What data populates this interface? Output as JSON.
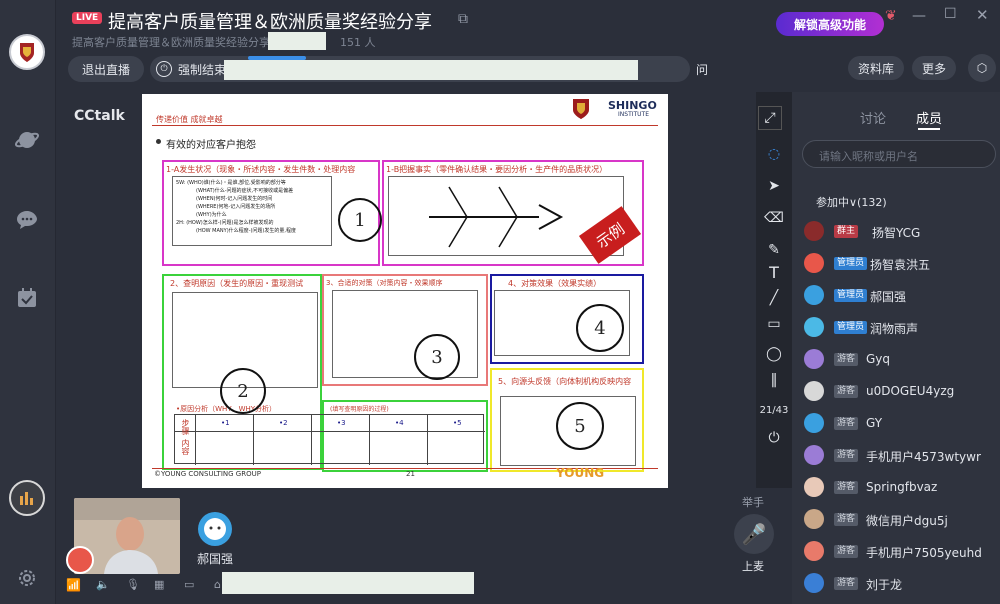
{
  "header": {
    "live_badge": "LIVE",
    "title": "提高客户质量管理＆欧洲质量奖经验分享",
    "subtitle": "提高客户质量管理＆欧洲质量奖经验分享",
    "viewers": "151 人",
    "exit_label": "退出直播",
    "force_end_label": "强制结束",
    "trailing_text": "问"
  },
  "promo": {
    "label": "解锁高级功能"
  },
  "toolbar": {
    "library_label": "资料库",
    "more_label": "更多"
  },
  "brand": {
    "cctalk": "CCtalk"
  },
  "slide": {
    "slogan": "传递价值 成就卓越",
    "logo_text": "SHINGO",
    "logo_sub": "INSTITUTE",
    "heading": "有效的对应客户抱怨",
    "sec1a": "1-A发生状况（现象・所述内容・发生件数・处理内容",
    "sec1b": "1-B把握事实（零件确认结果・要因分析・生产件的品质状况）",
    "sec2": "2、查明原因（发生的原因・重现测试",
    "sec3": "3、合适的对策（对策内容・效果顺序",
    "sec4": "4、对策效果（效果实绩）",
    "sec5": "5、向源头反馈（向体制机构反映内容",
    "w5h": [
      "5W:  (WHO)谁(什么)・是谁,部位,受影响的部分等",
      "(WHAT)什么-问题的症状,不可接收或是偏差",
      "(WHEN)何时-记入问题发生的时间",
      "(WHERE)何地-记入问题发生的场所",
      "(WHY)为什么",
      "2H:  (HOW)怎么样-(问题)是怎么样被发现的",
      "(HOW MANY)什么程度-(问题)发生的量,程度"
    ],
    "stamp": "示例",
    "nums": [
      "1",
      "2",
      "3",
      "4",
      "5"
    ],
    "why_label": "•原因分析（WHY、WHY分析）",
    "fill_label": "(填写查明原因的过程)",
    "steps_label": "步骤",
    "content_label": "内容",
    "step_cols": [
      "•1",
      "•2",
      "•3",
      "•4",
      "•5"
    ],
    "footer_left": "©YOUNG CONSULTING GROUP",
    "page_no": "21",
    "footer_brand": "YOUNG"
  },
  "tools": {
    "page": "21/43"
  },
  "panel": {
    "tab_discuss": "讨论",
    "tab_members": "成员",
    "search_placeholder": "请输入昵称或用户名",
    "joined": "参加中∨(132)"
  },
  "members": [
    {
      "badge": "群主",
      "type": "host",
      "name": "扬智YCG",
      "avatar_color": "#8a2b2b"
    },
    {
      "badge": "管理员",
      "type": "admin",
      "name": "扬智袁洪五",
      "avatar_color": "#e8574a"
    },
    {
      "badge": "管理员",
      "type": "admin",
      "name": "郝国强",
      "avatar_color": "#3aa0e0"
    },
    {
      "badge": "管理员",
      "type": "admin",
      "name": "润物雨声",
      "avatar_color": "#4bb9e6"
    },
    {
      "badge": "游客",
      "type": "guest",
      "name": "Gyq",
      "avatar_color": "#9b7cd6"
    },
    {
      "badge": "游客",
      "type": "guest",
      "name": "u0DOGEU4yzg",
      "avatar_color": "#d8d8d8"
    },
    {
      "badge": "游客",
      "type": "guest",
      "name": "GY",
      "avatar_color": "#3aa0e0"
    },
    {
      "badge": "游客",
      "type": "guest",
      "name": "手机用户4573wtywr",
      "avatar_color": "#9b7cd6"
    },
    {
      "badge": "游客",
      "type": "guest",
      "name": "Springfbvaz",
      "avatar_color": "#e8c9b8"
    },
    {
      "badge": "游客",
      "type": "guest",
      "name": "微信用户dgu5j",
      "avatar_color": "#c9a788"
    },
    {
      "badge": "游客",
      "type": "guest",
      "name": "手机用户7505yeuhd",
      "avatar_color": "#e87a6a"
    },
    {
      "badge": "游客",
      "type": "guest",
      "name": "刘于龙",
      "avatar_color": "#3a7fd6"
    }
  ],
  "bottom": {
    "speaker_name": "郝国强",
    "raise_hand": "举手",
    "mic_label": "上麦"
  }
}
